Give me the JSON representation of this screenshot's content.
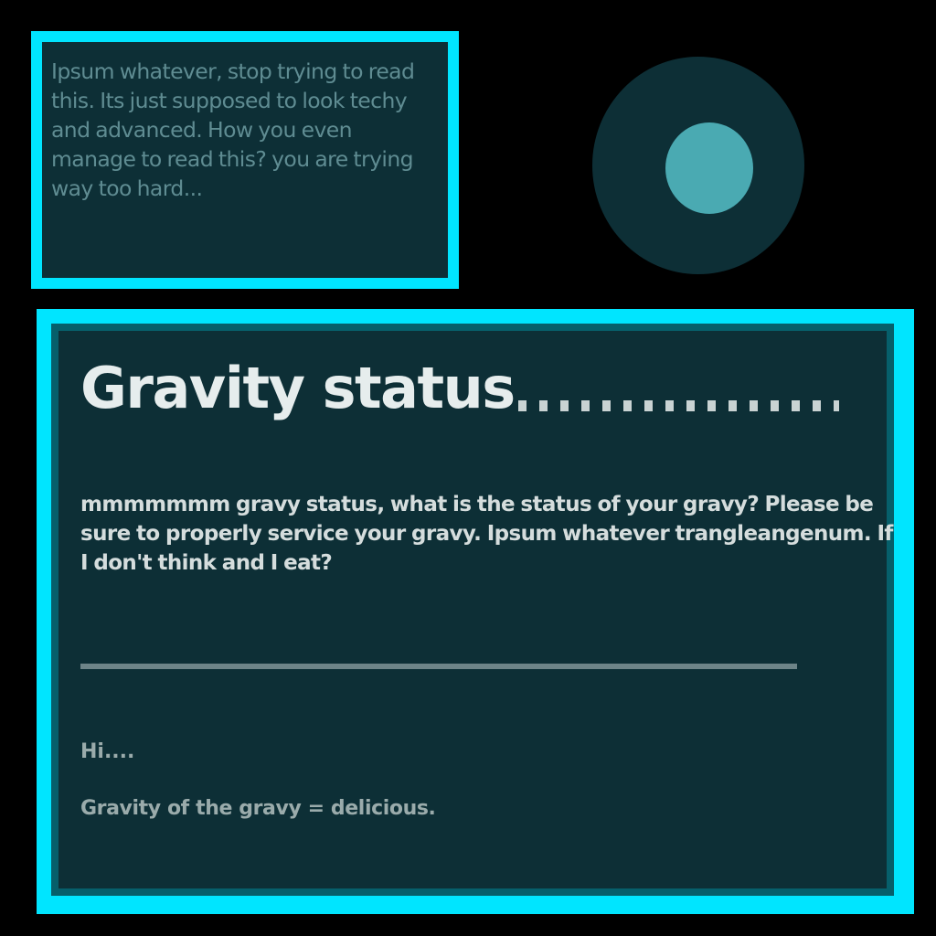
{
  "info_panel": {
    "text": "Ipsum whatever, stop trying to read this. Its just supposed to look techy and advanced. How you even manage to read this? you are trying way too hard..."
  },
  "indicator": {
    "icon": "orb-icon",
    "ring_color": "#0d2f36",
    "core_color": "#4aaab2"
  },
  "status_panel": {
    "title": "Gravity status",
    "body": "mmmmmmm gravy status, what is the status of your gravy? Please be sure to properly service your gravy. Ipsum whatever trangleangenum. If I don't think and I eat?",
    "note_short": "Hi....",
    "note_long": "Gravity of the gravy = delicious."
  },
  "colors": {
    "background": "#000000",
    "accent": "#00e5ff",
    "panel": "#0d2f36"
  }
}
